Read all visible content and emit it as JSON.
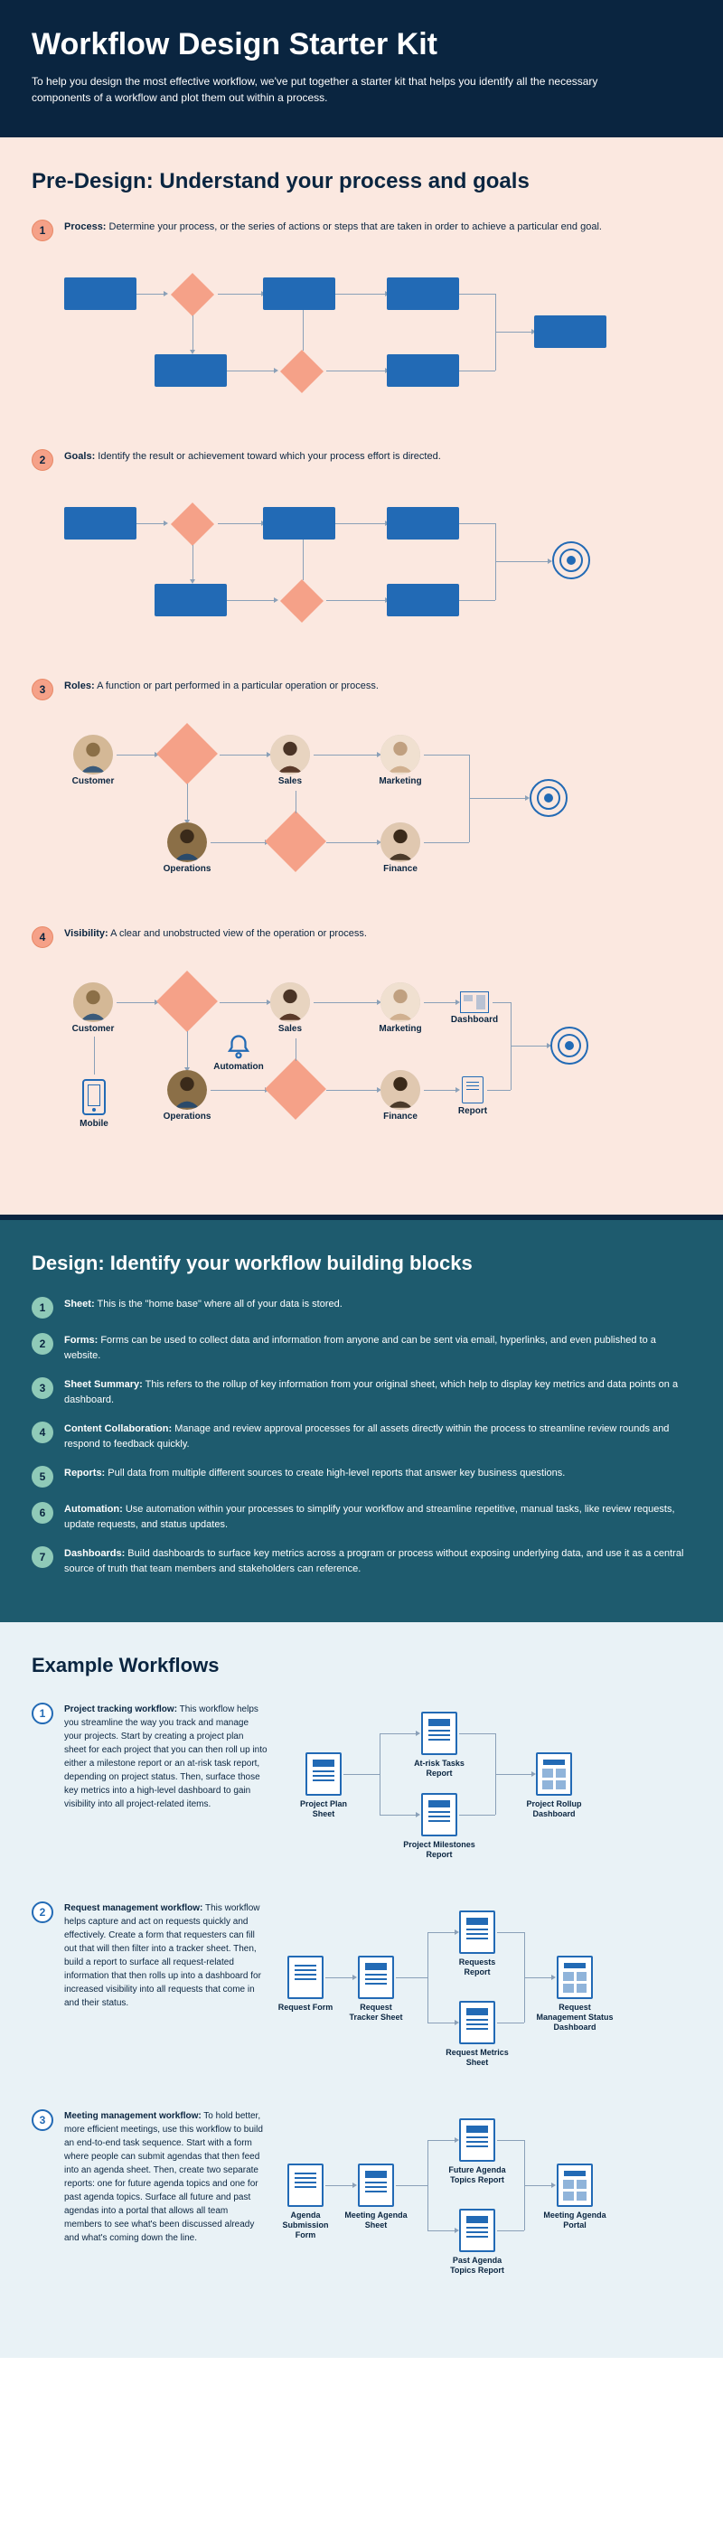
{
  "header": {
    "title": "Workflow Design Starter Kit",
    "subtitle": "To help you design the most effective workflow, we've put together a starter kit that helps you identify all the necessary components of a workflow and plot them out within a process."
  },
  "predesign": {
    "title": "Pre-Design: Understand your process and goals",
    "items": [
      {
        "num": "1",
        "label": "Process:",
        "text": " Determine your process, or the series of actions or steps that are taken in order to achieve a particular end goal."
      },
      {
        "num": "2",
        "label": "Goals:",
        "text": " Identify the result or achievement toward which your process effort is directed."
      },
      {
        "num": "3",
        "label": "Roles:",
        "text": " A function or part performed in a particular operation or process."
      },
      {
        "num": "4",
        "label": "Visibility:",
        "text": " A clear and unobstructed view of the operation or process."
      }
    ],
    "roles": {
      "customer": "Customer",
      "sales": "Sales",
      "marketing": "Marketing",
      "operations": "Operations",
      "finance": "Finance",
      "automation": "Automation",
      "mobile": "Mobile",
      "dashboard": "Dashboard",
      "report": "Report"
    }
  },
  "design": {
    "title": "Design: Identify your workflow building blocks",
    "items": [
      {
        "num": "1",
        "label": "Sheet:",
        "text": " This is the \"home base\" where all of your data is stored."
      },
      {
        "num": "2",
        "label": "Forms:",
        "text": " Forms can be used to collect data and information from anyone and can be sent via email, hyperlinks, and even published to a website."
      },
      {
        "num": "3",
        "label": "Sheet Summary:",
        "text": " This refers to the rollup of key information from your original sheet, which help to display key metrics and data points on a dashboard."
      },
      {
        "num": "4",
        "label": "Content Collaboration:",
        "text": " Manage and review approval processes for all assets directly within the process to streamline review rounds and respond to feedback quickly."
      },
      {
        "num": "5",
        "label": "Reports:",
        "text": " Pull data from multiple different sources to create high-level reports that answer key business questions."
      },
      {
        "num": "6",
        "label": "Automation:",
        "text": " Use automation within your processes to simplify your workflow and streamline repetitive, manual tasks, like review requests, update requests, and status updates."
      },
      {
        "num": "7",
        "label": "Dashboards:",
        "text": " Build dashboards to surface key metrics across a program or process without exposing underlying data, and use it as a central source of truth that team members and stakeholders can reference."
      }
    ]
  },
  "examples": {
    "title": "Example Workflows",
    "items": [
      {
        "num": "1",
        "label": "Project tracking workflow:",
        "text": " This workflow helps you streamline the way you track and manage your projects. Start by creating a project plan sheet for each project that you can then roll up into either a milestone report or an at-risk task report, depending on project status. Then, surface those key metrics into a high-level dashboard to gain visibility into all project-related items.",
        "nodes": {
          "a": "Project Plan Sheet",
          "b": "At-risk Tasks Report",
          "c": "Project Milestones Report",
          "d": "Project Rollup Dashboard"
        }
      },
      {
        "num": "2",
        "label": "Request management workflow:",
        "text": " This workflow helps capture and act on requests quickly and effectively. Create a form that requesters can fill out that will then filter into a tracker sheet. Then, build a report to surface all request-related information that then rolls up into a dashboard for increased visibility into all requests that come in and their status.",
        "nodes": {
          "a": "Request Form",
          "b": "Request Tracker Sheet",
          "c": "Requests Report",
          "d": "Request Metrics Sheet",
          "e": "Request Management Status Dashboard"
        }
      },
      {
        "num": "3",
        "label": "Meeting management workflow:",
        "text": " To hold better, more efficient meetings, use this workflow to build an end-to-end task sequence. Start with a form where people can submit agendas that then feed into an agenda sheet. Then, create two separate reports: one for future agenda topics and one for past agenda topics. Surface all future and past agendas into a portal that allows all team members to see what's been discussed already and what's coming down the line.",
        "nodes": {
          "a": "Agenda Submission Form",
          "b": "Meeting Agenda Sheet",
          "c": "Future Agenda Topics Report",
          "d": "Past Agenda Topics Report",
          "e": "Meeting Agenda Portal"
        }
      }
    ]
  }
}
